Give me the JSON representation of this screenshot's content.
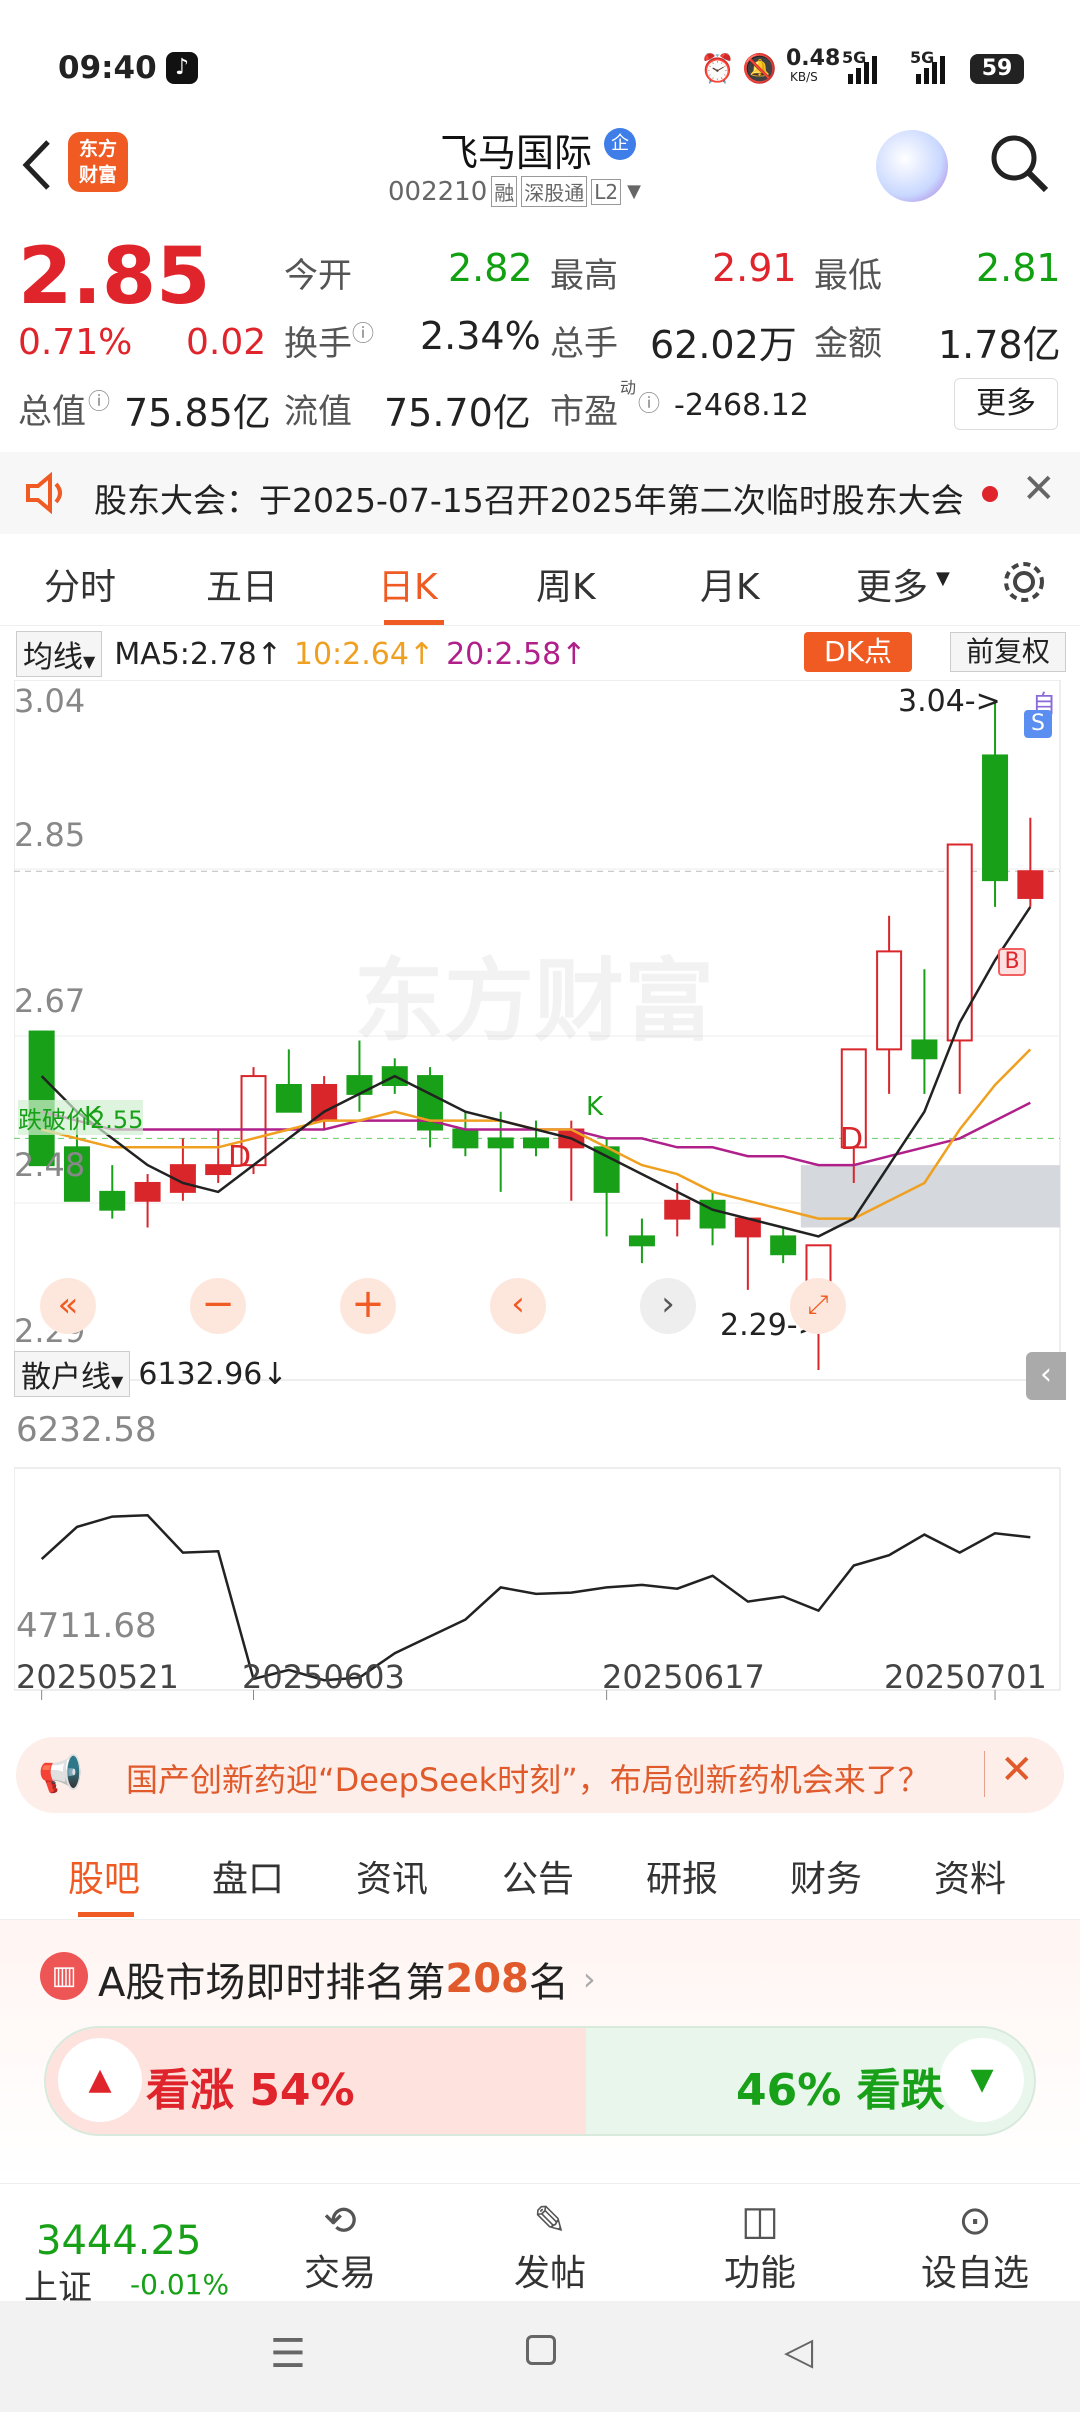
{
  "status": {
    "time": "09:40",
    "net_speed": "0.48",
    "net_unit": "KB/S",
    "signal1": "5G",
    "signal2": "5G",
    "battery": "59"
  },
  "header": {
    "logo_line1": "东方",
    "logo_line2": "财富",
    "stock_name": "飞马国际",
    "badge": "企",
    "code": "002210",
    "tag1": "融",
    "tag2": "深股通",
    "tag3": "L2"
  },
  "quote": {
    "price": "2.85",
    "pct": "0.71%",
    "chg": "0.02",
    "open_label": "今开",
    "open": "2.82",
    "high_label": "最高",
    "high": "2.91",
    "low_label": "最低",
    "low": "2.81",
    "turnover_label": "换手",
    "turnover": "2.34%",
    "volume_label": "总手",
    "volume": "62.02万",
    "amount_label": "金额",
    "amount": "1.78亿",
    "mcap_label": "总值",
    "mcap": "75.85亿",
    "float_label": "流值",
    "float": "75.70亿",
    "pe_label": "市盈",
    "pe_sup": "动",
    "pe": "-2468.12",
    "more": "更多"
  },
  "notice": {
    "text": "股东大会：于2025-07-15召开2025年第二次临时股东大会"
  },
  "tabs": [
    "分时",
    "五日",
    "日K",
    "周K",
    "月K",
    "更多"
  ],
  "chart": {
    "ma_select": "均线",
    "ma5": "MA5:2.78",
    "ma10": "10:2.64",
    "ma20": "20:2.58",
    "arrow": "↑",
    "dk": "DK点",
    "fq": "前复权",
    "y_labels": [
      "3.04",
      "2.85",
      "2.67",
      "2.48",
      "2.29"
    ],
    "high_mark": "3.04->",
    "low_mark": "2.29->",
    "cost_label": "跌破价2.55",
    "watermark": "东方财富",
    "self_tag": "自",
    "s_tag": "S",
    "b_tag": "B",
    "k_tag": "K",
    "d_tag": "D",
    "sub_select": "散户线",
    "sub_value": "6132.96↓",
    "sub_max": "6232.58",
    "sub_min": "4711.68",
    "dates": [
      "20250521",
      "20250603",
      "20250617",
      "20250701"
    ],
    "colors": {
      "up": "#d9262b",
      "down": "#18a018",
      "ma5": "#222222",
      "ma10": "#f0a020",
      "ma20": "#b0208a"
    }
  },
  "chart_data": {
    "type": "candlestick",
    "candles": [
      {
        "o": 2.67,
        "h": 2.67,
        "l": 2.52,
        "c": 2.52
      },
      {
        "o": 2.54,
        "h": 2.58,
        "l": 2.48,
        "c": 2.48
      },
      {
        "o": 2.49,
        "h": 2.52,
        "l": 2.46,
        "c": 2.47
      },
      {
        "o": 2.48,
        "h": 2.51,
        "l": 2.45,
        "c": 2.5
      },
      {
        "o": 2.49,
        "h": 2.55,
        "l": 2.48,
        "c": 2.52
      },
      {
        "o": 2.51,
        "h": 2.56,
        "l": 2.5,
        "c": 2.52
      },
      {
        "o": 2.52,
        "h": 2.63,
        "l": 2.51,
        "c": 2.62
      },
      {
        "o": 2.61,
        "h": 2.65,
        "l": 2.58,
        "c": 2.58
      },
      {
        "o": 2.57,
        "h": 2.62,
        "l": 2.56,
        "c": 2.61
      },
      {
        "o": 2.62,
        "h": 2.66,
        "l": 2.58,
        "c": 2.6
      },
      {
        "o": 2.63,
        "h": 2.64,
        "l": 2.6,
        "c": 2.61
      },
      {
        "o": 2.62,
        "h": 2.63,
        "l": 2.54,
        "c": 2.56
      },
      {
        "o": 2.56,
        "h": 2.58,
        "l": 2.53,
        "c": 2.54
      },
      {
        "o": 2.55,
        "h": 2.58,
        "l": 2.49,
        "c": 2.54
      },
      {
        "o": 2.55,
        "h": 2.57,
        "l": 2.53,
        "c": 2.54
      },
      {
        "o": 2.54,
        "h": 2.57,
        "l": 2.48,
        "c": 2.56
      },
      {
        "o": 2.54,
        "h": 2.55,
        "l": 2.44,
        "c": 2.49
      },
      {
        "o": 2.44,
        "h": 2.46,
        "l": 2.41,
        "c": 2.43
      },
      {
        "o": 2.46,
        "h": 2.5,
        "l": 2.44,
        "c": 2.48
      },
      {
        "o": 2.48,
        "h": 2.49,
        "l": 2.43,
        "c": 2.45
      },
      {
        "o": 2.44,
        "h": 2.46,
        "l": 2.38,
        "c": 2.46
      },
      {
        "o": 2.44,
        "h": 2.45,
        "l": 2.41,
        "c": 2.42
      },
      {
        "o": 2.38,
        "h": 2.43,
        "l": 2.29,
        "c": 2.43
      },
      {
        "o": 2.54,
        "h": 2.54,
        "l": 2.5,
        "c": 2.65
      },
      {
        "o": 2.65,
        "h": 2.8,
        "l": 2.6,
        "c": 2.76
      },
      {
        "o": 2.66,
        "h": 2.74,
        "l": 2.6,
        "c": 2.64
      },
      {
        "o": 2.66,
        "h": 2.88,
        "l": 2.6,
        "c": 2.88
      },
      {
        "o": 2.98,
        "h": 3.04,
        "l": 2.81,
        "c": 2.84
      },
      {
        "o": 2.82,
        "h": 2.91,
        "l": 2.81,
        "c": 2.85
      }
    ],
    "ma5": [
      2.62,
      2.58,
      2.55,
      2.52,
      2.5,
      2.49,
      2.52,
      2.55,
      2.58,
      2.6,
      2.62,
      2.6,
      2.58,
      2.57,
      2.56,
      2.55,
      2.53,
      2.51,
      2.49,
      2.47,
      2.46,
      2.45,
      2.44,
      2.46,
      2.52,
      2.58,
      2.68,
      2.75,
      2.81
    ],
    "ma10": [
      2.56,
      2.55,
      2.54,
      2.54,
      2.54,
      2.54,
      2.55,
      2.56,
      2.57,
      2.57,
      2.58,
      2.57,
      2.57,
      2.57,
      2.56,
      2.56,
      2.54,
      2.52,
      2.51,
      2.49,
      2.48,
      2.47,
      2.46,
      2.46,
      2.48,
      2.5,
      2.56,
      2.61,
      2.65
    ],
    "ma20": [
      2.58,
      2.57,
      2.56,
      2.56,
      2.56,
      2.56,
      2.56,
      2.56,
      2.56,
      2.57,
      2.57,
      2.57,
      2.56,
      2.56,
      2.56,
      2.56,
      2.55,
      2.55,
      2.54,
      2.54,
      2.53,
      2.53,
      2.52,
      2.52,
      2.53,
      2.54,
      2.55,
      2.57,
      2.59
    ],
    "retail_line": [
      5650,
      5900,
      5980,
      5990,
      5700,
      5710,
      4720,
      4790,
      4710,
      4730,
      4920,
      5050,
      5180,
      5430,
      5380,
      5390,
      5430,
      5450,
      5420,
      5520,
      5320,
      5360,
      5250,
      5600,
      5680,
      5840,
      5700,
      5850,
      5820
    ],
    "ylim": [
      2.29,
      3.04
    ],
    "sub_ylim": [
      4711.68,
      6232.58
    ]
  },
  "banner": {
    "text": "国产创新药迎“DeepSeek时刻”，布局创新药机会来了？"
  },
  "subtabs": [
    "股吧",
    "盘口",
    "资讯",
    "公告",
    "研报",
    "财务",
    "资料"
  ],
  "rank": {
    "prefix": "A股市场即时排名第",
    "num": "208",
    "suffix": "名",
    "up_label": "看涨 54%",
    "down_label": "46% 看跌",
    "up_pct": 54
  },
  "bottom": {
    "index_value": "3444.25",
    "index_name": "上证",
    "index_chg": "-0.01%",
    "trade": "交易",
    "post": "发帖",
    "func": "功能",
    "fav": "设自选"
  }
}
